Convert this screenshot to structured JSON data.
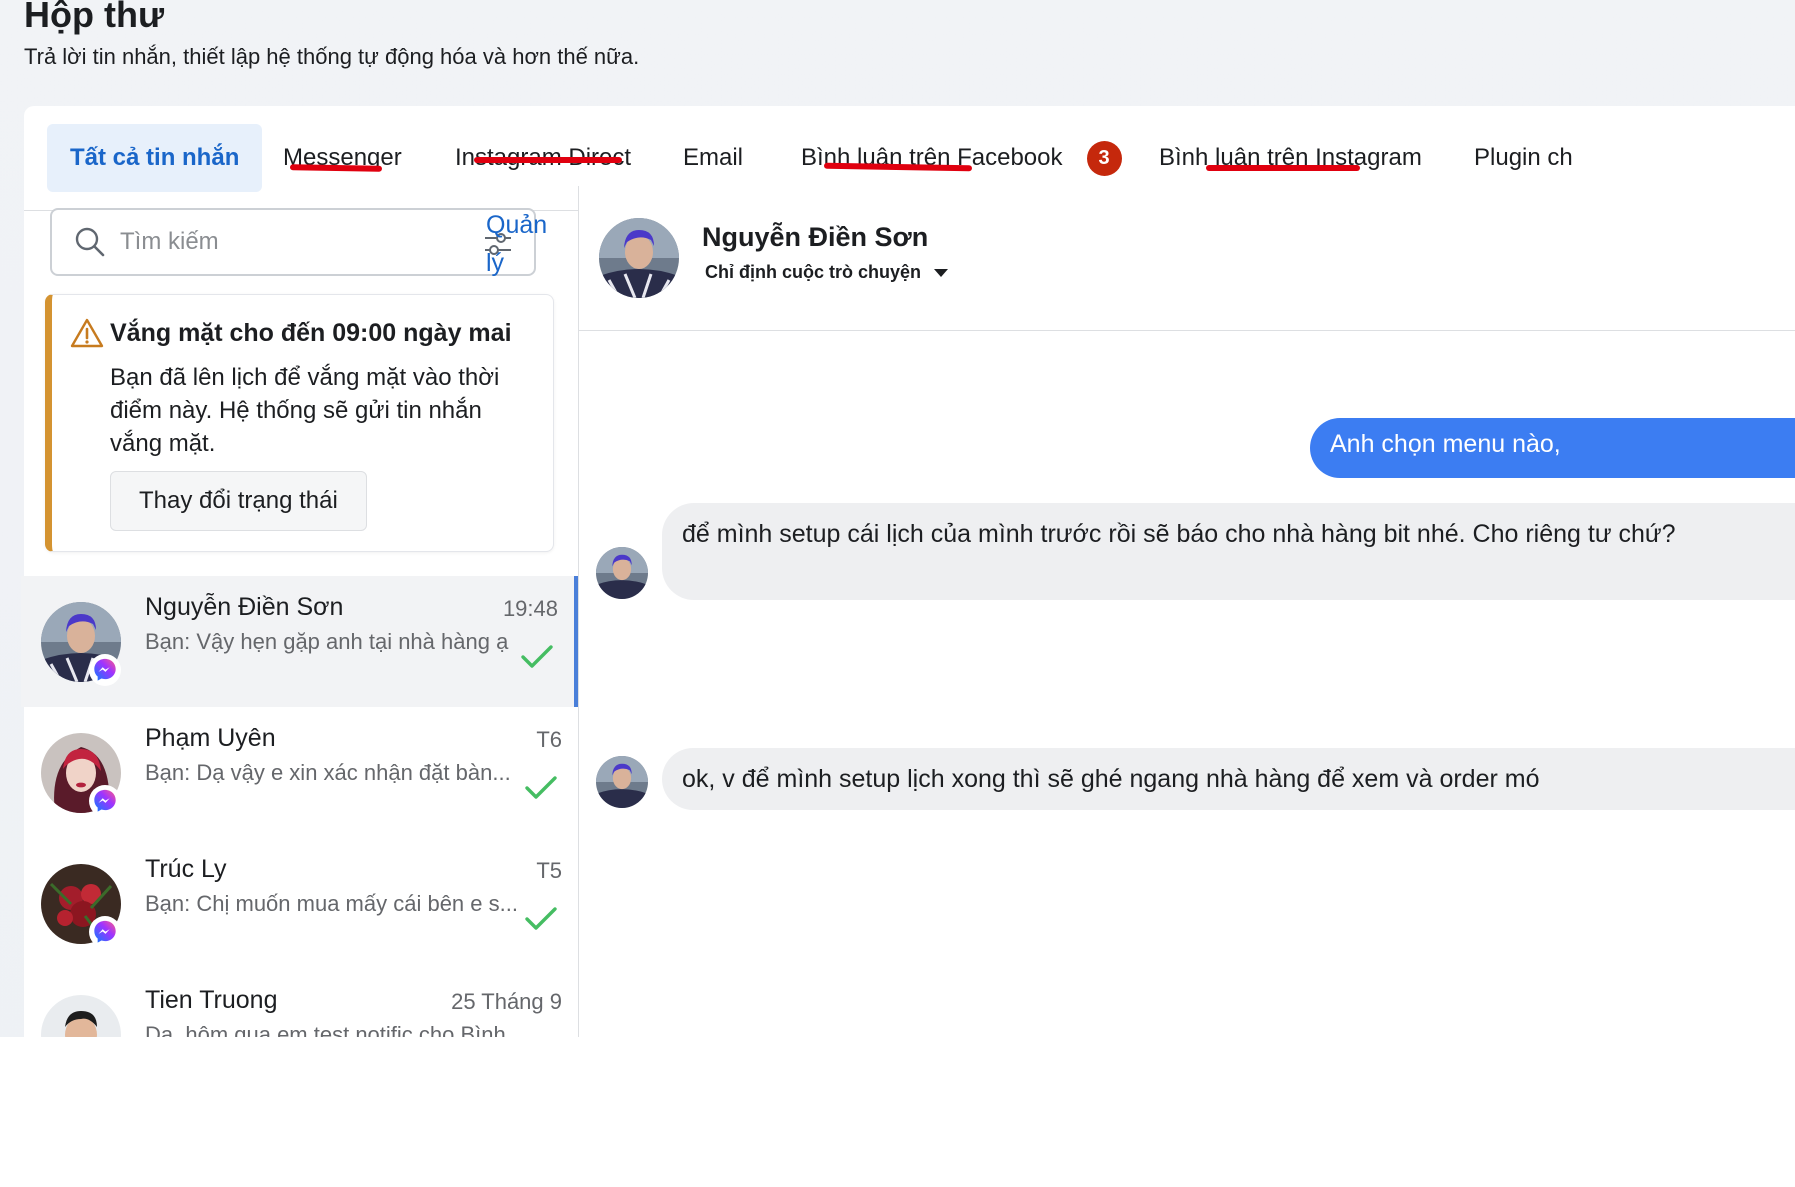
{
  "header": {
    "title": "Hộp thư",
    "subtitle": "Trả lời tin nhắn, thiết lập hệ thống tự động hóa và hơn thế nữa."
  },
  "tabs": [
    {
      "label": "Tất cả tin nhắn",
      "active": true
    },
    {
      "label": "Messenger"
    },
    {
      "label": "Instagram Direct"
    },
    {
      "label": "Email"
    },
    {
      "label": "Bình luận trên Facebook",
      "badge": "3"
    },
    {
      "label": "Bình luận trên Instagram"
    },
    {
      "label": "Plugin ch"
    }
  ],
  "search": {
    "placeholder": "Tìm kiếm",
    "manage_label": "Quản lý"
  },
  "away_notice": {
    "title": "Vắng mặt cho đến 09:00 ngày mai",
    "body": "Bạn đã lên lịch để vắng mặt vào thời điểm này. Hệ thống sẽ gửi tin nhắn vắng mặt.",
    "button": "Thay đổi trạng thái"
  },
  "conversations": [
    {
      "name": "Nguyễn Điền Sơn",
      "preview": "Bạn: Vậy hẹn gặp anh tại nhà hàng ạ",
      "time": "19:48",
      "selected": true
    },
    {
      "name": "Phạm Uyên",
      "preview": "Bạn: Dạ vậy e xin xác nhận đặt bàn...",
      "time": "T6"
    },
    {
      "name": "Trúc Ly",
      "preview": "Bạn: Chị muốn mua mấy cái bên e s...",
      "time": "T5"
    },
    {
      "name": "Tien Truong",
      "preview": "Dạ, hôm qua em test notific cho Bình",
      "time": "25 Tháng 9"
    }
  ],
  "chat": {
    "contact_name": "Nguyễn Điền Sơn",
    "assign_label": "Chỉ định cuộc trò chuyện",
    "messages": [
      {
        "direction": "out",
        "text": "Anh chọn menu nào,"
      },
      {
        "direction": "in",
        "text": "để mình setup cái lịch của mình trước rồi sẽ báo cho nhà hàng bit nhé. Cho riêng tư chứ?"
      },
      {
        "direction": "in",
        "text": "ok, v để mình setup lịch xong thì sẽ ghé ngang nhà hàng để xem và order mó"
      }
    ]
  },
  "colors": {
    "accent": "#1a66c9",
    "active_tab_bg": "#e7f0fb",
    "badge": "#c5280c",
    "annotation_underline": "#e0000f",
    "out_bubble": "#3c7df2",
    "in_bubble": "#eeeff1",
    "away_border": "#d49331",
    "check": "#45bd62"
  }
}
